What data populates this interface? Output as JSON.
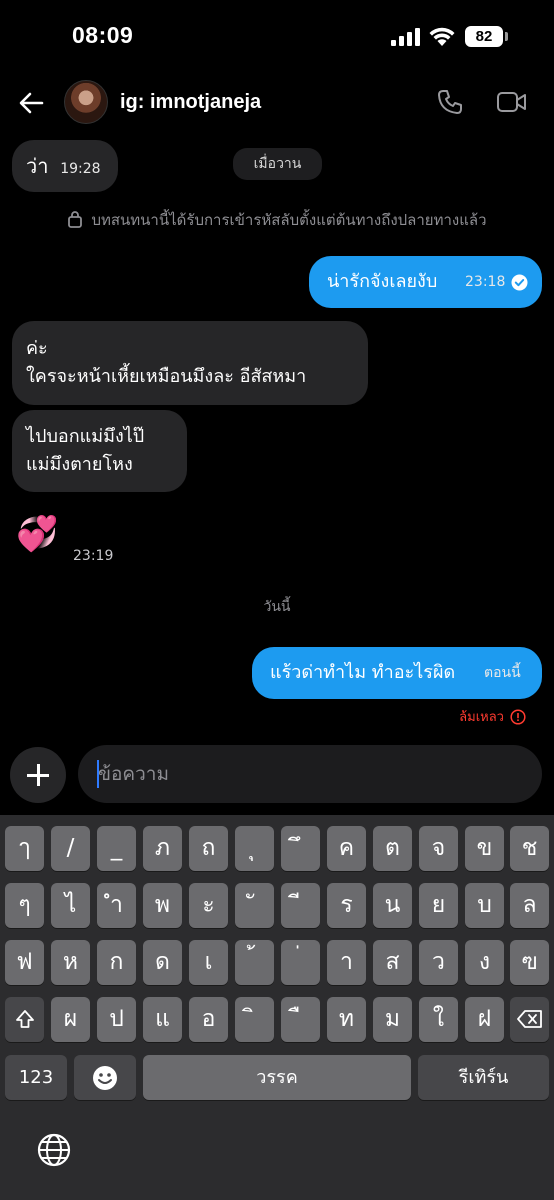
{
  "status_bar": {
    "time": "08:09",
    "battery": "82"
  },
  "header": {
    "contact_name": "ig: imnotjaneja"
  },
  "messages": {
    "m1": {
      "text": "ว่า",
      "time": "19:28"
    },
    "date_yesterday": "เมื่อวาน",
    "encryption_notice": "บทสนทนานี้ได้รับการเข้ารหัสลับตั้งแต่ต้นทางถึงปลายทางแล้ว",
    "m2": {
      "text": "น่ารักจังเลยงับ",
      "time": "23:18"
    },
    "m3": {
      "line1": "ค่ะ",
      "line2": "ใครจะหน้าเหี้ยเหมือนมึงละ อีสัสหมา"
    },
    "m4": {
      "line1": "ไปบอกแม่มึงไป๊",
      "line2": "แม่มึงตายโหง"
    },
    "m5": {
      "emoji": "💞",
      "time": "23:19"
    },
    "date_today": "วันนี้",
    "m6": {
      "text": "แร้วด่าทำไม ทำอะไรผิด",
      "time": "ตอนนี้"
    },
    "failed_label": "ล้มเหลว"
  },
  "composer": {
    "placeholder": "ข้อความ"
  },
  "keyboard": {
    "row1": [
      "ๅ",
      "/",
      "_",
      "ภ",
      "ถ",
      "ุ",
      "ึ",
      "ค",
      "ต",
      "จ",
      "ข",
      "ช"
    ],
    "row2": [
      "ๆ",
      "ไ",
      "ำ",
      "พ",
      "ะ",
      "ั",
      "ี",
      "ร",
      "น",
      "ย",
      "บ",
      "ล"
    ],
    "row3": [
      "ฟ",
      "ห",
      "ก",
      "ด",
      "เ",
      "้",
      "่",
      "า",
      "ส",
      "ว",
      "ง",
      "ฃ"
    ],
    "row4": [
      "ผ",
      "ป",
      "แ",
      "อ",
      "ิ",
      "ื",
      "ท",
      "ม",
      "ใ",
      "ฝ"
    ],
    "numbers_key": "123",
    "space_key": "วรรค",
    "return_key": "รีเทิร์น"
  },
  "colors": {
    "accent": "#1d9bf0",
    "error": "#ff3b30",
    "incoming_bubble": "#262628"
  }
}
